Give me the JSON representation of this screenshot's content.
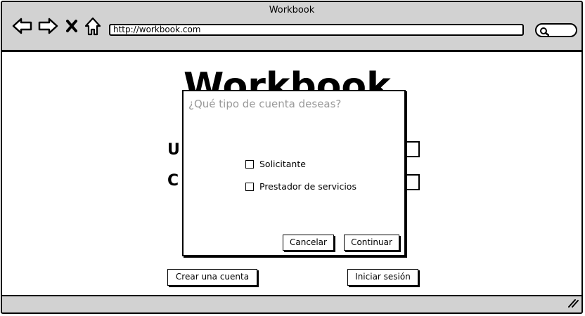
{
  "window": {
    "title": "Workbook",
    "url": "http://workbook.com"
  },
  "icons": {
    "back": "back-arrow-icon",
    "forward": "forward-arrow-icon",
    "stop": "close-icon",
    "home": "home-icon",
    "search": "search-icon",
    "resize": "resize-grip-icon"
  },
  "page": {
    "app_title": "Workbook",
    "field1_letter": "U",
    "field2_letter": "C",
    "create_account_label": "Crear una cuenta",
    "login_label": "Iniciar sesión"
  },
  "dialog": {
    "title": "¿Qué tipo de cuenta deseas?",
    "options": [
      {
        "label": "Solicitante",
        "checked": false
      },
      {
        "label": "Prestador de servicios",
        "checked": false
      }
    ],
    "cancel_label": "Cancelar",
    "continue_label": "Continuar"
  }
}
